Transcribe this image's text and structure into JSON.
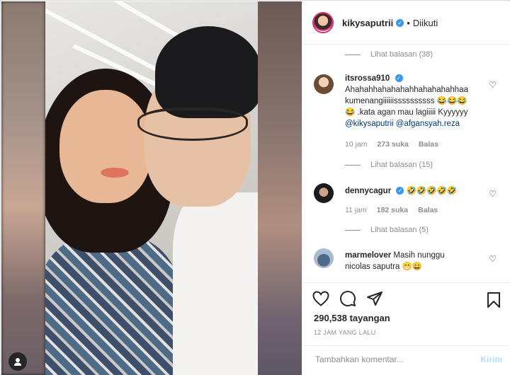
{
  "post": {
    "username": "kikysaputrii",
    "separator": "•",
    "follow_status": "Diikuti",
    "more_icon": "more-horizontal-icon"
  },
  "comments": [
    {
      "type": "reply-toggle",
      "label": "Lihat balasan (38)"
    },
    {
      "type": "comment",
      "username": "itsrossa910",
      "text_lines": [
        "Ahahahhahahahahhahahahahhaa",
        "kumenangiiiiiissssssssss 😂😂😂",
        "😂 .kata agan mau lagiiiii Kyyyyyy"
      ],
      "mentions": [
        "@kikysaputrii",
        "@afgansyah.reza"
      ],
      "time": "10 jam",
      "likes": "273 suka",
      "reply": "Balas",
      "reply_toggle": "Lihat balasan (15)"
    },
    {
      "type": "comment",
      "username": "dennycagur",
      "text": "🤣🤣🤣🤣🤣",
      "time": "11 jam",
      "likes": "182 suka",
      "reply": "Balas",
      "reply_toggle": "Lihat balasan (5)"
    },
    {
      "type": "comment",
      "username": "marmelover",
      "text_lines": [
        "Masih nunggu",
        "nicolas saputra 😁😄"
      ]
    }
  ],
  "actions": {
    "views": "290,538 tayangan",
    "time_ago": "12 JAM YANG LALU"
  },
  "comment_input": {
    "placeholder": "Tambahkan komentar...",
    "send_label": "Kirim"
  },
  "colors": {
    "verified": "#3897f0",
    "send_disabled": "#b2dffc",
    "muted": "#8e8e8e",
    "mention": "#00376b"
  }
}
